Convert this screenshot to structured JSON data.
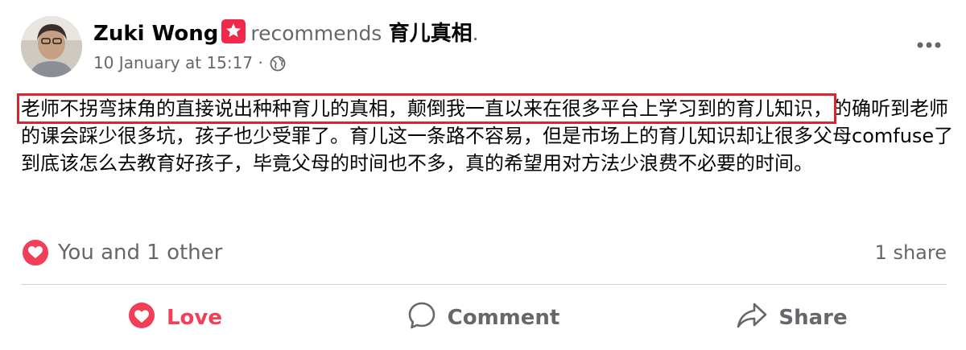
{
  "post": {
    "author": "Zuki Wong",
    "action_text": "recommends",
    "page_name": "育儿真相",
    "punctuation": ".",
    "timestamp": "10 January at 15:17",
    "separator": "·",
    "audience_icon": "globe-icon",
    "more_icon": "more-horizontal-icon",
    "text_highlighted": "老师不拐弯抹角的直接说出种种育儿的真相，颠倒我一直以来在很多平台上学习到的育儿知识，",
    "text_rest": "的确听到老师的课会踩少很多坑，孩子也少受罪了。育儿这一条路不容易，但是市场上的育儿知识却让很多父母comfuse了到底该怎么去教育好孩子，毕竟父母的时间也不多，真的希望用对方法少浪费不必要的时间。"
  },
  "reactions": {
    "icon": "love-reaction-icon",
    "summary": "You and 1 other",
    "shares": "1 share"
  },
  "actions": {
    "love_label": "Love",
    "comment_label": "Comment",
    "share_label": "Share"
  },
  "colors": {
    "love": "#f33e58",
    "highlight_border": "#d9252f",
    "secondary_text": "#65676b",
    "badge": "#f02849"
  }
}
